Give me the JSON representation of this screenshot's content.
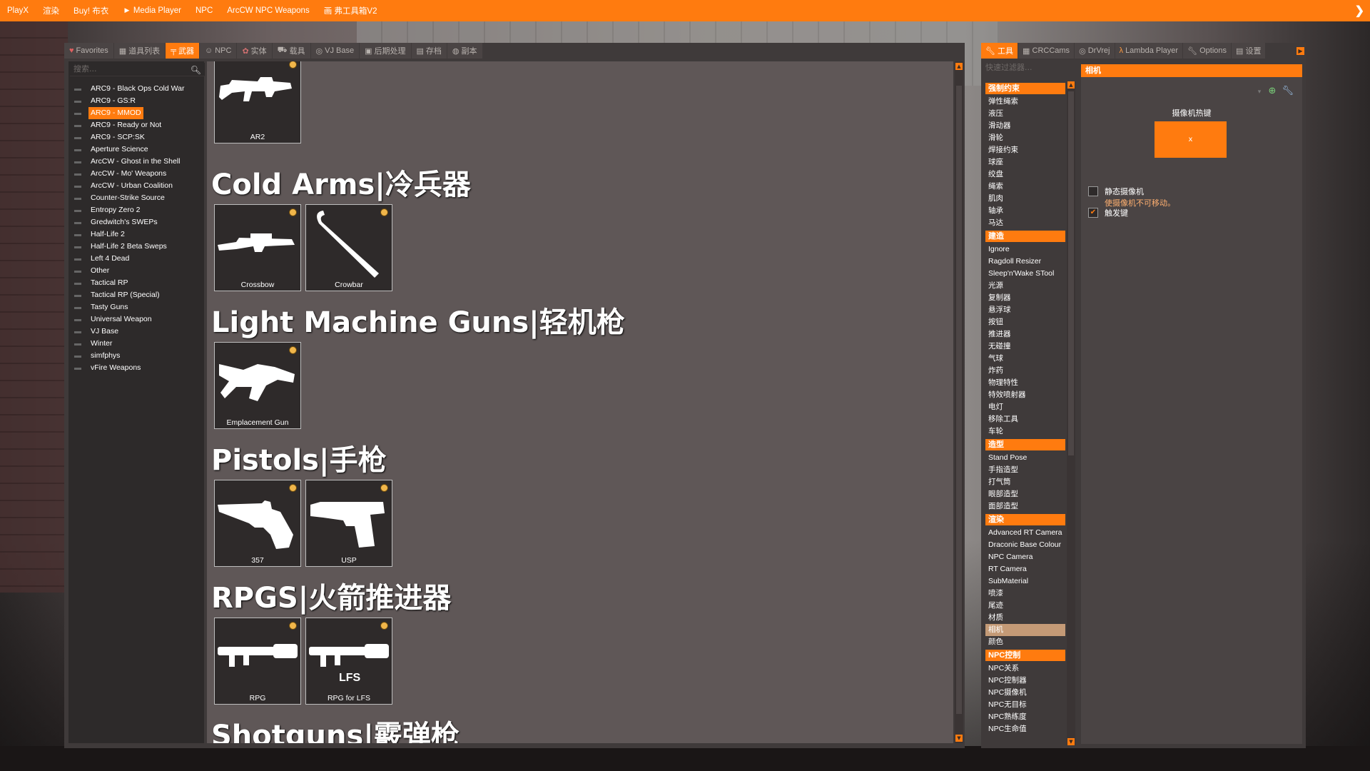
{
  "menubar": {
    "items": [
      "PlayX",
      "渲染",
      "Buy! 布衣",
      "► Media Player",
      "NPC",
      "ArcCW NPC Weapons",
      "画 弗工具箱V2"
    ],
    "close_icon": "chevron-right-icon"
  },
  "spawnmenu": {
    "tabs": [
      {
        "label": "Favorites",
        "icon": "heart-icon"
      },
      {
        "label": "道具列表",
        "icon": "grid-icon"
      },
      {
        "label": "武器",
        "icon": "gun-icon"
      },
      {
        "label": "NPC",
        "icon": "face-icon"
      },
      {
        "label": "实体",
        "icon": "entity-icon"
      },
      {
        "label": "载具",
        "icon": "car-icon"
      },
      {
        "label": "VJ Base",
        "icon": "vj-icon"
      },
      {
        "label": "后期处理",
        "icon": "postprocess-icon"
      },
      {
        "label": "存档",
        "icon": "save-icon"
      },
      {
        "label": "副本",
        "icon": "dupe-icon"
      }
    ],
    "active_tab": "武器",
    "search_placeholder": "搜索...",
    "tree": [
      "ARC9 - Black Ops Cold War",
      "ARC9 - GS:R",
      "ARC9 - MMOD",
      "ARC9 - Ready or Not",
      "ARC9 - SCP:SK",
      "Aperture Science",
      "ArcCW - Ghost in the Shell",
      "ArcCW - Mo' Weapons",
      "ArcCW - Urban Coalition",
      "Counter-Strike Source",
      "Entropy Zero 2",
      "Gredwitch's SWEPs",
      "Half-Life 2",
      "Half-Life 2 Beta Sweps",
      "Left 4 Dead",
      "Other",
      "Tactical RP",
      "Tactical RP (Special)",
      "Tasty Guns",
      "Universal Weapon",
      "VJ Base",
      "Winter",
      "simfphys",
      "vFire Weapons"
    ],
    "selected_tree_item": "ARC9 - MMOD",
    "categories": [
      {
        "title": "Cold Arms|冷兵器"
      },
      {
        "title": "Light Machine Guns|轻机枪"
      },
      {
        "title": "Pistols|手枪"
      },
      {
        "title": "RPGS|火箭推进器"
      },
      {
        "title": "Shotguns|霰弹枪"
      }
    ],
    "weapons": [
      {
        "label": "AR2",
        "icon": "ar2-icon"
      },
      {
        "label": "Crossbow",
        "icon": "crossbow-icon"
      },
      {
        "label": "Crowbar",
        "icon": "crowbar-icon"
      },
      {
        "label": "Emplacement Gun",
        "icon": "emplacement-gun-icon"
      },
      {
        "label": "357",
        "icon": "revolver-icon"
      },
      {
        "label": "USP",
        "icon": "pistol-icon"
      },
      {
        "label": "RPG",
        "icon": "rpg-icon"
      },
      {
        "label": "RPG for LFS",
        "icon": "rpg-lfs-icon",
        "overlay": "LFS"
      }
    ]
  },
  "toolmenu": {
    "tabs": [
      {
        "label": "工具",
        "icon": "wrench-icon"
      },
      {
        "label": "CRCCams",
        "icon": "grid-icon"
      },
      {
        "label": "DrVrej",
        "icon": "vj-icon"
      },
      {
        "label": "Lambda Player",
        "icon": "lambda-icon"
      },
      {
        "label": "Options",
        "icon": "wrench-icon"
      },
      {
        "label": "设置",
        "icon": "settings-icon"
      }
    ],
    "active_tab": "工具",
    "filter_placeholder": "快速过滤器...",
    "groups": [
      {
        "title": "强制约束",
        "items": [
          "弹性绳索",
          "液压",
          "滑动器",
          "滑轮",
          "焊接约束",
          "球座",
          "绞盘",
          "绳索",
          "肌肉",
          "轴承",
          "马达"
        ]
      },
      {
        "title": "建造",
        "items": [
          "Ignore",
          "Ragdoll Resizer",
          "Sleep'n'Wake STool",
          "光源",
          "复制器",
          "悬浮球",
          "按钮",
          "推进器",
          "无碰撞",
          "气球",
          "炸药",
          "物理特性",
          "特效喷射器",
          "电灯",
          "移除工具",
          "车轮"
        ]
      },
      {
        "title": "造型",
        "items": [
          "Stand Pose",
          "手指造型",
          "打气筒",
          "眼部造型",
          "面部造型"
        ]
      },
      {
        "title": "渲染",
        "items": [
          "Advanced RT Camera",
          "Draconic Base Colour",
          "NPC Camera",
          "RT Camera",
          "SubMaterial",
          "喷漆",
          "尾迹",
          "材质",
          "相机",
          "颜色"
        ]
      },
      {
        "title": "NPC控制",
        "items": [
          "NPC关系",
          "NPC控制器",
          "NPC摄像机",
          "NPC无目标",
          "NPC熟练度",
          "NPC生命值"
        ]
      }
    ],
    "selected_tool": "相机",
    "panel": {
      "title": "相机",
      "hotkey_label": "摄像机热键",
      "hotkey_value": "x",
      "static_label": "静态摄像机",
      "static_desc": "使摄像机不可移动。",
      "static_checked": false,
      "toggle_label": "触发键",
      "toggle_checked": true
    }
  }
}
